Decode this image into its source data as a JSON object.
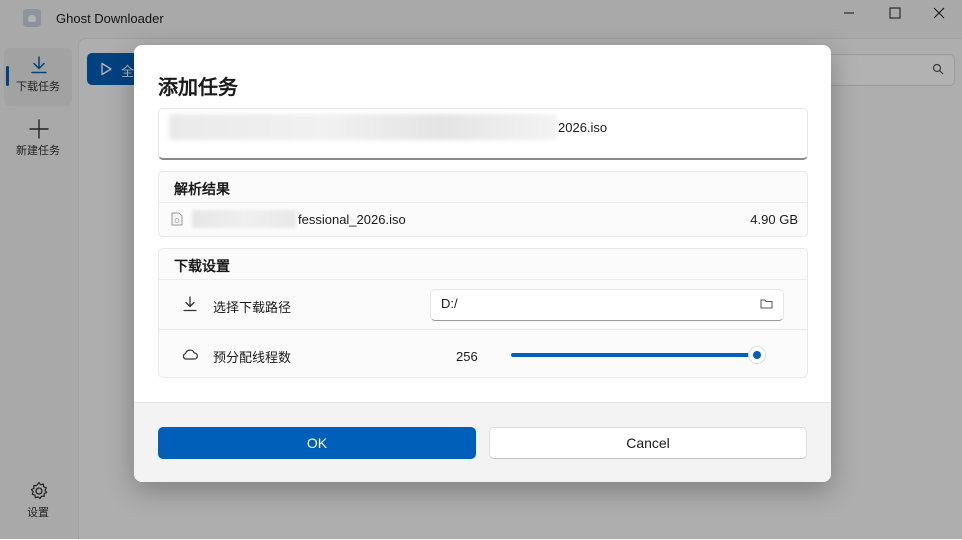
{
  "window": {
    "title": "Ghost Downloader",
    "controls": {
      "minimize": "—",
      "maximize": "☐",
      "close": "✕"
    }
  },
  "sidebar": {
    "items": [
      {
        "label": "下载任务",
        "icon": "download-icon"
      },
      {
        "label": "新建任务",
        "icon": "plus-icon"
      }
    ],
    "settings_label": "设置"
  },
  "content": {
    "start_button_label": "全"
  },
  "dialog": {
    "title": "添加任务",
    "url_visible_text": "2026.iso",
    "parse": {
      "heading": "解析结果",
      "file_name_visible": "fessional_2026.iso",
      "file_size": "4.90 GB"
    },
    "settings": {
      "heading": "下载设置",
      "path_label": "选择下载路径",
      "path_value": "D:/",
      "threads_label": "预分配线程数",
      "threads_value": "256",
      "threads_fraction": 1.0
    },
    "ok_label": "OK",
    "cancel_label": "Cancel"
  },
  "colors": {
    "accent": "#005fb8"
  }
}
